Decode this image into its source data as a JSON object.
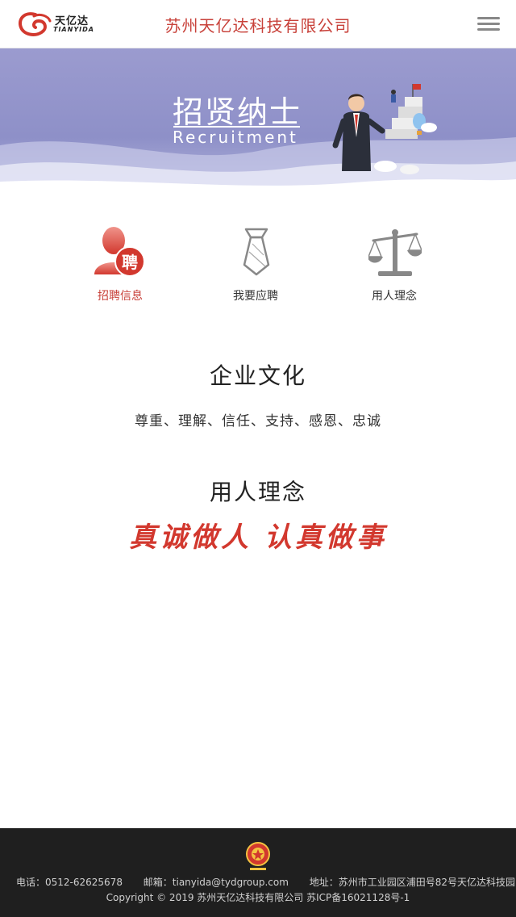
{
  "header": {
    "logo_cn": "天亿达",
    "logo_en": "TIANYIDA",
    "company_title": "苏州天亿达科技有限公司",
    "menu_icon": "hamburger-menu-icon"
  },
  "banner": {
    "title": "招贤纳士",
    "subtitle": "Recruitment",
    "illustration": "businessman-illustration"
  },
  "tabs": [
    {
      "label": "招聘信息",
      "icon": "recruit-person-icon",
      "active": true
    },
    {
      "label": "我要应聘",
      "icon": "tie-icon",
      "active": false
    },
    {
      "label": "用人理念",
      "icon": "scale-icon",
      "active": false
    }
  ],
  "culture": {
    "title": "企业文化",
    "text": "尊重、理解、信任、支持、感恩、忠诚"
  },
  "philosophy": {
    "title": "用人理念",
    "motto": "真诚做人  认真做事"
  },
  "footer": {
    "badge_icon": "business-license-badge-icon",
    "phone": "电话：0512-62625678",
    "email": "邮箱：tianyida@tydgroup.com",
    "address": "地址：苏州市工业园区浦田号82号天亿达科技园",
    "copyright": "Copyright © 2019 苏州天亿达科技有限公司  苏ICP备16021128号-1"
  },
  "colors": {
    "accent": "#c8413a",
    "banner": "#8e90c8",
    "footer_bg": "#1f1f1f"
  }
}
